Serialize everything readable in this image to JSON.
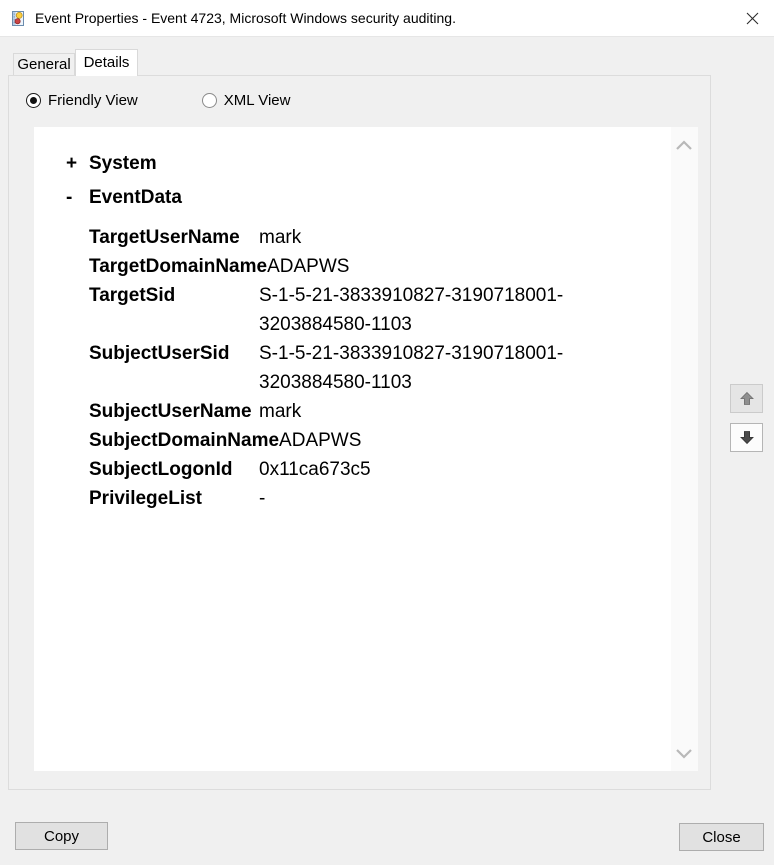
{
  "window": {
    "title": "Event Properties - Event 4723, Microsoft Windows security auditing."
  },
  "tabs": {
    "general": "General",
    "details": "Details",
    "selected": "Details"
  },
  "view_options": {
    "friendly_label": "Friendly View",
    "xml_label": "XML View",
    "selected": "Friendly View"
  },
  "tree": {
    "system": {
      "toggle": "+",
      "label": "System",
      "expanded": false
    },
    "eventdata": {
      "toggle": "-",
      "label": "EventData",
      "expanded": true
    },
    "rows": [
      {
        "name": "TargetUserName",
        "value": "mark"
      },
      {
        "name": "TargetDomainName",
        "value": "ADAPWS"
      },
      {
        "name": "TargetSid",
        "value": "S-1-5-21-3833910827-3190718001-3203884580-1103"
      },
      {
        "name": "SubjectUserSid",
        "value": "S-1-5-21-3833910827-3190718001-3203884580-1103"
      },
      {
        "name": "SubjectUserName",
        "value": "mark"
      },
      {
        "name": "SubjectDomainName",
        "value": "ADAPWS"
      },
      {
        "name": "SubjectLogonId",
        "value": "0x11ca673c5"
      },
      {
        "name": "PrivilegeList",
        "value": "-"
      }
    ]
  },
  "buttons": {
    "copy": "Copy",
    "close": "Close"
  },
  "icons": {
    "titlebar": "event-log-icon",
    "close": "close-x-icon",
    "nav_up": "arrow-up-icon",
    "nav_down": "arrow-down-icon"
  },
  "colors": {
    "dialog_bg": "#f0f0f0",
    "titlebar_bg": "#ffffff",
    "content_bg": "#ffffff",
    "button_face": "#e1e1e1",
    "button_border": "#adadad",
    "icon_yellow": "#fccf3e",
    "icon_red": "#cc4444",
    "chevron_gray": "#b8b8b8"
  }
}
